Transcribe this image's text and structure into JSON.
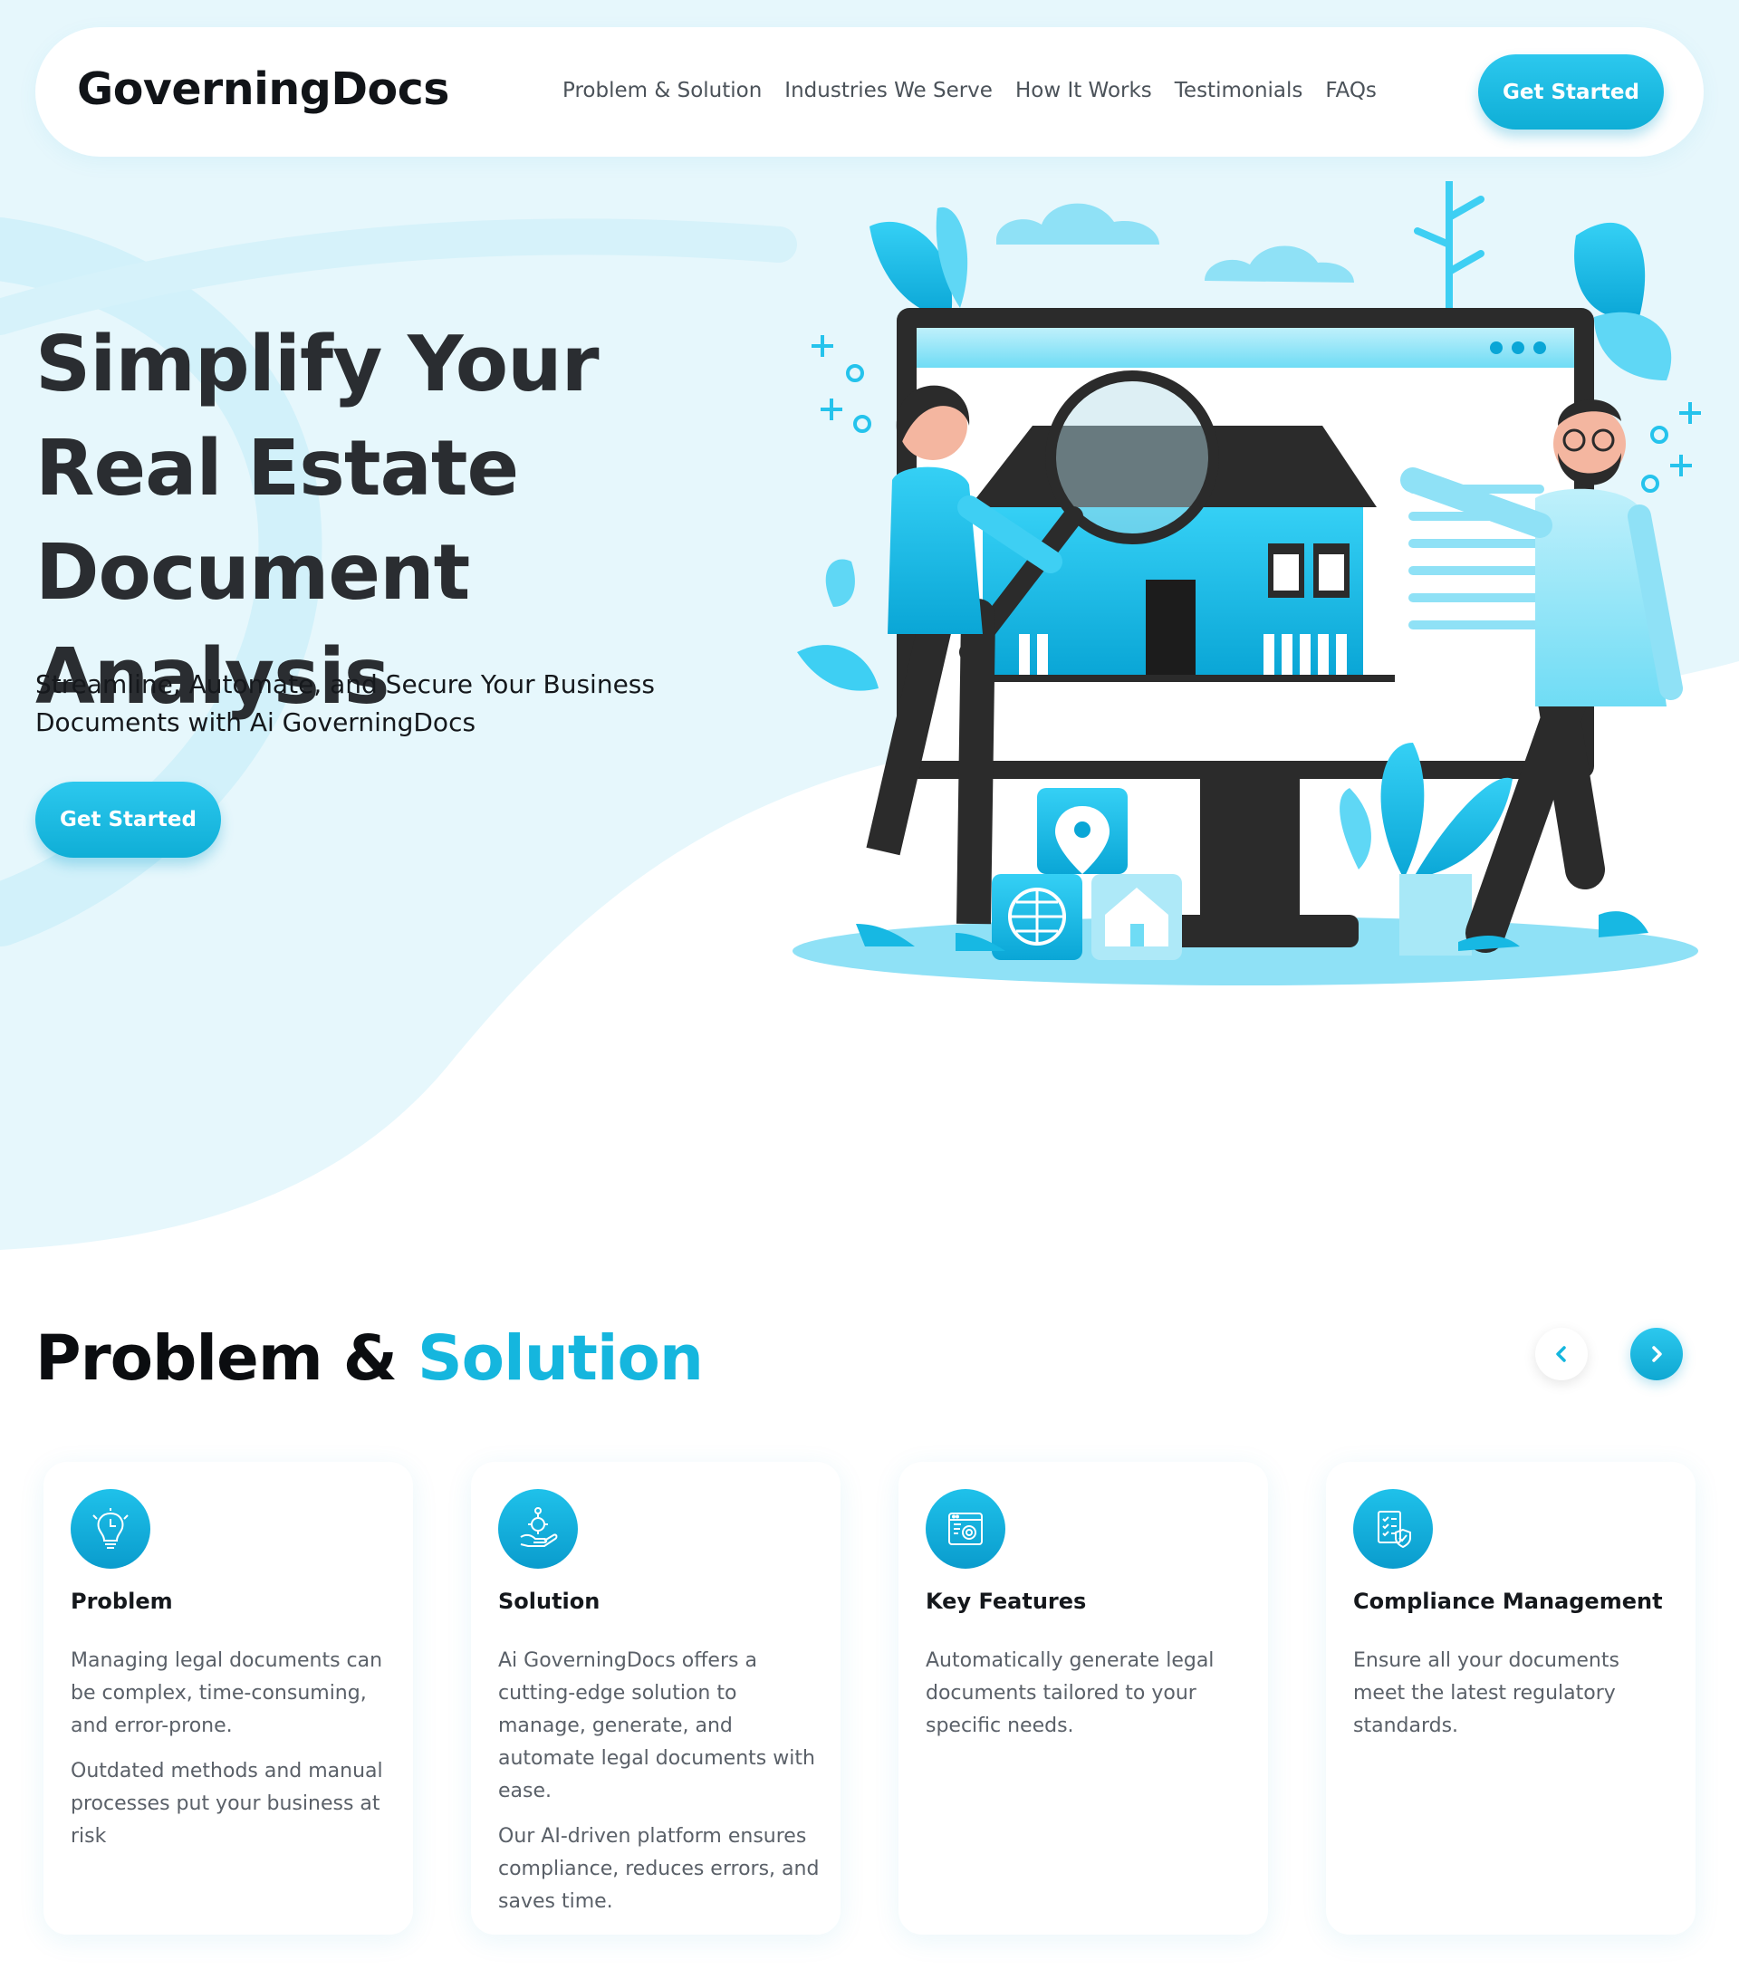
{
  "brand": {
    "name": "GoverningDocs",
    "accent_color": "#15b6de",
    "hero_bg": "#e6f7fc"
  },
  "nav": {
    "items": [
      "Problem & Solution",
      "Industries We Serve",
      "How It Works",
      "Testimonials",
      "FAQs"
    ],
    "cta": "Get Started"
  },
  "hero": {
    "title": "Simplify Your Real Estate Document Analysis",
    "subtitle": "Streamline, Automate, and Secure Your Business Documents with Ai GoverningDocs",
    "cta": "Get Started"
  },
  "section": {
    "title_main": "Problem & ",
    "title_accent": "Solution",
    "prev_icon": "chevron-left-icon",
    "next_icon": "chevron-right-icon"
  },
  "cards": [
    {
      "icon": "lightbulb-puzzle-icon",
      "title": "Problem",
      "paragraphs": [
        "Managing legal documents can be complex, time-consuming, and error-prone.",
        "Outdated methods and manual processes put your business at risk"
      ]
    },
    {
      "icon": "hand-gear-icon",
      "title": "Solution",
      "paragraphs": [
        "Ai GoverningDocs offers a cutting-edge solution to manage, generate, and automate legal documents with ease.",
        "Our AI-driven platform ensures compliance, reduces errors, and saves time."
      ]
    },
    {
      "icon": "browser-gear-icon",
      "title": "Key Features",
      "paragraphs": [
        "Automatically generate legal documents tailored to your specific needs."
      ]
    },
    {
      "icon": "checklist-shield-icon",
      "title": "Compliance Management",
      "paragraphs": [
        "Ensure all your documents meet the latest regulatory standards."
      ]
    }
  ]
}
